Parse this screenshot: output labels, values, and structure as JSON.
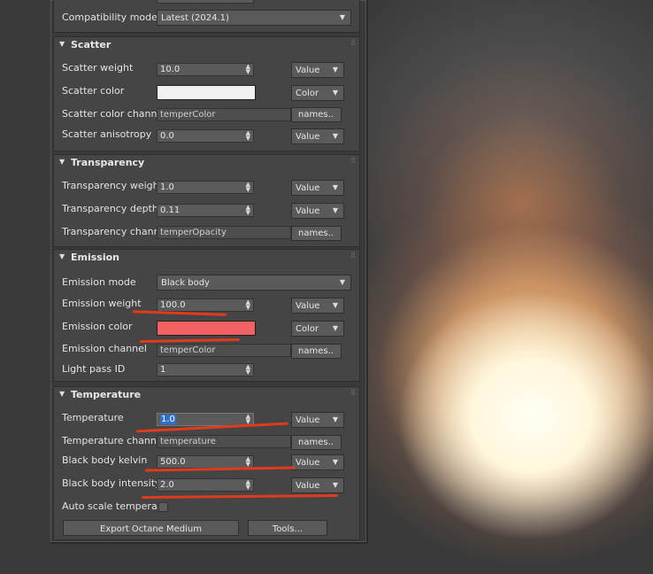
{
  "top": {
    "compat_label": "Compatibility mode",
    "compat_value": "Latest (2024.1)"
  },
  "scatter": {
    "title": "Scatter",
    "weight_label": "Scatter weight",
    "weight_value": "10.0",
    "weight_mode": "Value",
    "color_label": "Scatter color",
    "color_swatch": "#f2f2f2",
    "color_mode": "Color",
    "channel_label": "Scatter color channel",
    "channel_value": "temperColor",
    "names_label": "names..",
    "aniso_label": "Scatter anisotropy",
    "aniso_value": "0.0",
    "aniso_mode": "Value"
  },
  "transparency": {
    "title": "Transparency",
    "weight_label": "Transparency weight",
    "weight_value": "1.0",
    "weight_mode": "Value",
    "depth_label": "Transparency depth",
    "depth_value": "0.11",
    "depth_mode": "Value",
    "channel_label": "Transparency channel",
    "channel_value": "temperOpacity",
    "names_label": "names.."
  },
  "emission": {
    "title": "Emission",
    "mode_label": "Emission mode",
    "mode_value": "Black body",
    "weight_label": "Emission weight",
    "weight_value": "100.0",
    "weight_mode": "Value",
    "color_label": "Emission color",
    "color_swatch": "#f06262",
    "color_mode": "Color",
    "channel_label": "Emission channel",
    "channel_value": "temperColor",
    "names_label": "names..",
    "lightpass_label": "Light pass ID",
    "lightpass_value": "1"
  },
  "temperature": {
    "title": "Temperature",
    "temp_label": "Temperature",
    "temp_value": "1.0",
    "temp_mode": "Value",
    "channel_label": "Temperature channel",
    "channel_value": "temperature",
    "names_label": "names..",
    "kelvin_label": "Black body kelvin",
    "kelvin_value": "500.0",
    "kelvin_mode": "Value",
    "intensity_label": "Black body intensity",
    "intensity_value": "2.0",
    "intensity_mode": "Value",
    "autoscale_label": "Auto scale tempera..."
  },
  "footer": {
    "export_label": "Export Octane Medium",
    "tools_label": "Tools..."
  },
  "colors": {
    "annotation_red": "#e23a1d",
    "panel_bg": "#454545"
  }
}
